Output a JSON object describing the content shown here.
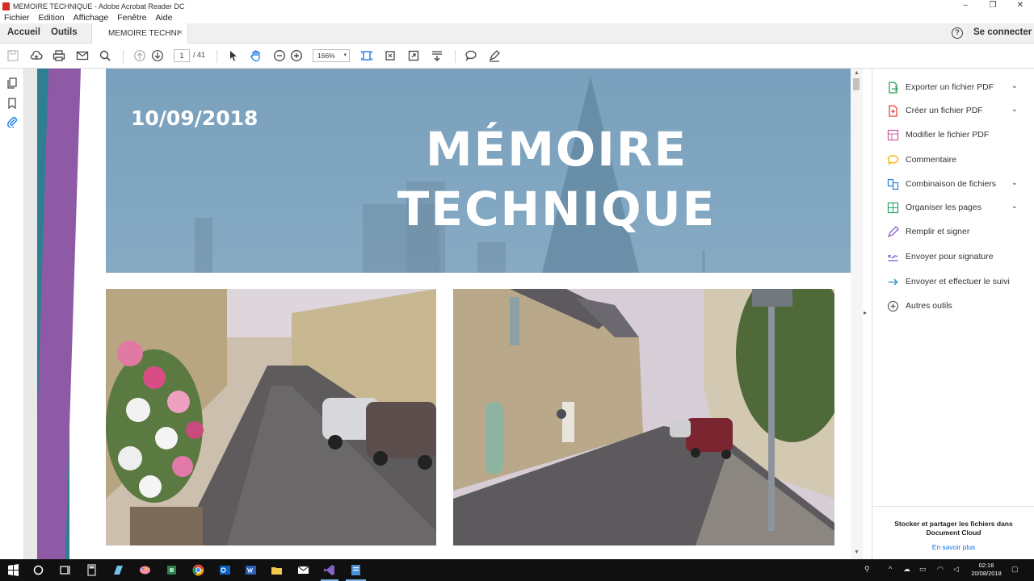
{
  "window": {
    "title": "MEMOIRE TECHNIQUE - Adobe Acrobat Reader DC",
    "minimize": "‒",
    "restore": "❐",
    "close": "✕"
  },
  "menu": [
    "Fichier",
    "Edition",
    "Affichage",
    "Fenêtre",
    "Aide"
  ],
  "tabs": {
    "home": "Accueil",
    "tools": "Outils",
    "document": "MEMOIRE TECHNI",
    "document_close": "×"
  },
  "header": {
    "help": "?",
    "signin": "Se connecter"
  },
  "toolbar": {
    "page_current": "1",
    "page_total": "/ 41",
    "zoom": "166%",
    "zoom_arrow": "▾"
  },
  "document": {
    "date": "10/09/2018",
    "title_line1": "MÉMOIRE",
    "title_line2": "TECHNIQUE"
  },
  "tools_panel": {
    "items": [
      {
        "label": "Exporter un fichier PDF",
        "icon": "export-pdf-icon",
        "color": "#2c9e5b",
        "expand": "⌄"
      },
      {
        "label": "Créer un fichier PDF",
        "icon": "create-pdf-icon",
        "color": "#e8473c",
        "expand": "⌄"
      },
      {
        "label": "Modifier le fichier PDF",
        "icon": "edit-pdf-icon",
        "color": "#d563a9",
        "expand": ""
      },
      {
        "label": "Commentaire",
        "icon": "comment-icon",
        "color": "#f2b705",
        "expand": ""
      },
      {
        "label": "Combinaison de fichiers",
        "icon": "combine-files-icon",
        "color": "#2b7fd8",
        "expand": "⌄"
      },
      {
        "label": "Organiser les pages",
        "icon": "organize-pages-icon",
        "color": "#2ba36b",
        "expand": "⌄"
      },
      {
        "label": "Remplir et signer",
        "icon": "fill-sign-icon",
        "color": "#8b5ccc",
        "expand": ""
      },
      {
        "label": "Envoyer pour signature",
        "icon": "send-signature-icon",
        "color": "#6e4fc4",
        "expand": ""
      },
      {
        "label": "Envoyer et effectuer le suivi",
        "icon": "send-track-icon",
        "color": "#1e8fc4",
        "expand": ""
      },
      {
        "label": "Autres outils",
        "icon": "more-tools-icon",
        "color": "#555555",
        "expand": ""
      }
    ],
    "cloud_text": "Stocker et partager les fichiers dans Document Cloud",
    "cloud_link": "En savoir plus"
  },
  "taskbar": {
    "clock_time": "02:16",
    "clock_date": "20/08/2018"
  },
  "colors": {
    "banner": "#7ea4bf",
    "stripe_teal": "#2f7f92",
    "stripe_purple": "#8e5aa6",
    "accent": "#1473e6"
  }
}
